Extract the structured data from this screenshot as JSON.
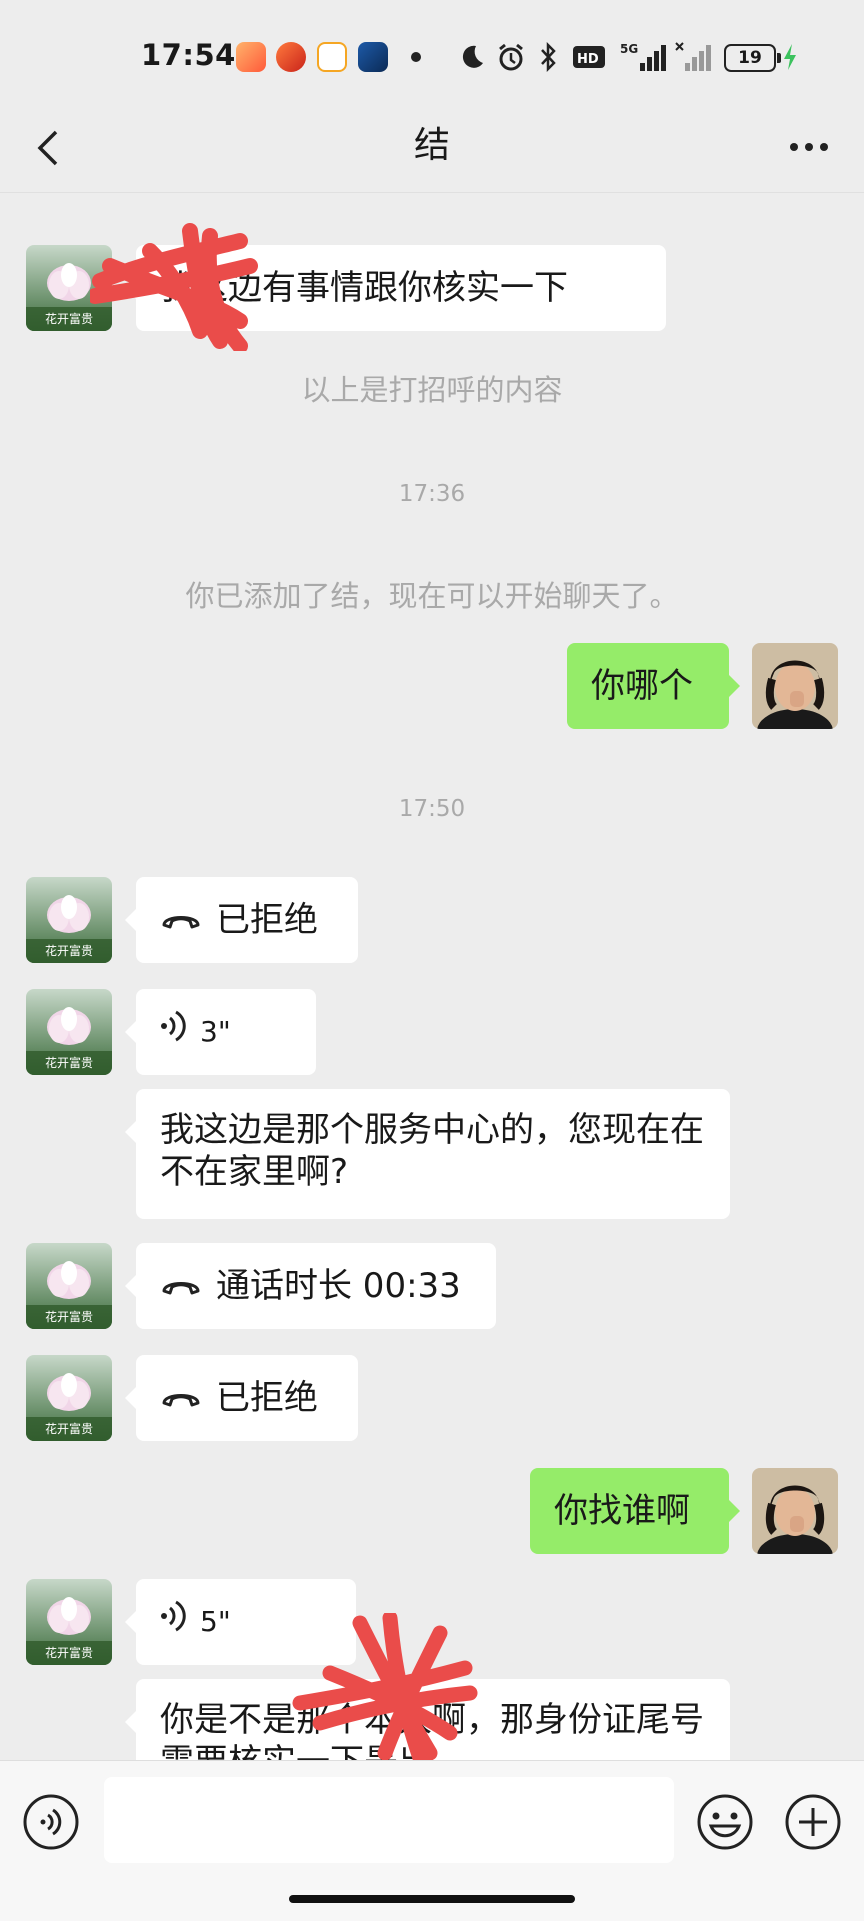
{
  "status": {
    "time": "17:54",
    "battery": "19"
  },
  "header": {
    "title": "结"
  },
  "contact": {
    "avatar_text": "花开富贵"
  },
  "messages": {
    "m1": "我这边有事情跟你核实一下",
    "sys1": "以上是打招呼的内容",
    "ts1": "17:36",
    "sys2": "你已添加了结，现在可以开始聊天了。",
    "m2": "你哪个",
    "ts2": "17:50",
    "m3": "已拒绝",
    "m4": "3\"",
    "m5": "我这边是那个服务中心的，您现在在不在家里啊?",
    "m6": "通话时长 00:33",
    "m7": "已拒绝",
    "m8": "你找谁啊",
    "m9": "5\"",
    "m10": "你是不是那个本人啊，那身份证尾号需要核实一下是出"
  },
  "colors": {
    "outgoing": "#95ec69",
    "background": "#ededed",
    "incoming": "#ffffff"
  }
}
